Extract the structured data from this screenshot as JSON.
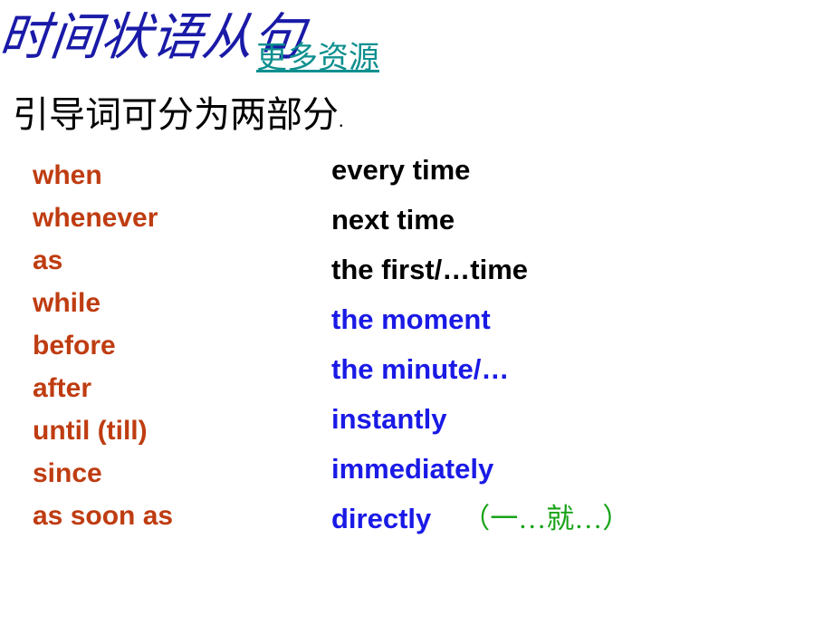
{
  "slide": {
    "title": "时间状语从句",
    "more_resources_link": "更多资源",
    "subtitle": "引导词可分为两部分",
    "subtitle_dot": ".",
    "left_column": [
      {
        "text": "when"
      },
      {
        "text": "whenever"
      },
      {
        "text": "as"
      },
      {
        "text": "while"
      },
      {
        "text": "before"
      },
      {
        "text": "after"
      },
      {
        "text": "until (till)"
      },
      {
        "text": "since"
      },
      {
        "text": "as soon as"
      }
    ],
    "right_column": [
      {
        "text": "every time",
        "color": "black"
      },
      {
        "text": "next time",
        "color": "black"
      },
      {
        "text": "the first/…time",
        "color": "black"
      },
      {
        "text": "the moment",
        "color": "blue"
      },
      {
        "text": "the minute/…",
        "color": "blue"
      },
      {
        "text": "instantly",
        "color": "blue"
      },
      {
        "text": "immediately",
        "color": "blue"
      },
      {
        "text": "directly",
        "color": "blue",
        "note": "（一…就…）",
        "note_color": "green"
      }
    ],
    "colors": {
      "title": "#1a1aa8",
      "link": "#0f8f8f",
      "left_items": "#bf3c11",
      "black_items": "#000000",
      "blue_items": "#1a1ae6",
      "note": "#17a317"
    }
  }
}
